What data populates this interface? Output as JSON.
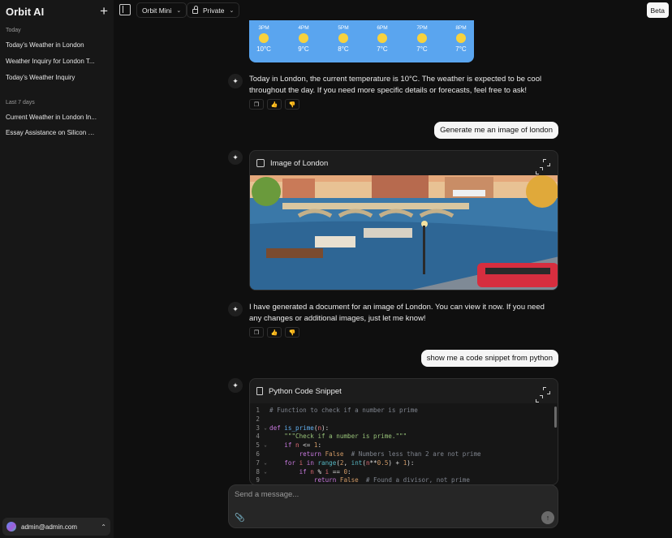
{
  "sidebar": {
    "title": "Orbit AI",
    "new_chat_icon": "plus-icon",
    "groups": [
      {
        "label": "Today",
        "items": [
          "Today's Weather in London",
          "Weather Inquiry for London T...",
          "Today's Weather Inquiry"
        ]
      },
      {
        "label": "Last 7 days",
        "items": [
          "Current Weather in London In...",
          "Essay Assistance on Silicon V..."
        ]
      }
    ],
    "user": {
      "email": "admin@admin.com"
    }
  },
  "topbar": {
    "model": "Orbit Mini",
    "visibility": "Private",
    "badge": "Beta"
  },
  "weather": {
    "hours": [
      {
        "time": "3PM",
        "temp": "10°C"
      },
      {
        "time": "4PM",
        "temp": "9°C"
      },
      {
        "time": "5PM",
        "temp": "8°C"
      },
      {
        "time": "6PM",
        "temp": "7°C"
      },
      {
        "time": "7PM",
        "temp": "7°C"
      },
      {
        "time": "8PM",
        "temp": "7°C"
      }
    ]
  },
  "messages": {
    "assistant_1": "Today in London, the current temperature is 10°C. The weather is expected to be cool throughout the day. If you need more specific details or forecasts, feel free to ask!",
    "user_1": "Generate me an image of london",
    "image_card_title": "Image of London",
    "assistant_2": "I have generated a document for an image of London. You can view it now. If you need any changes or additional images, just let me know!",
    "user_2": "show me a code snippet from python",
    "code_card_title": "Python Code Snippet"
  },
  "code": {
    "lines": [
      {
        "n": "1",
        "fold": "",
        "parts": [
          [
            "c",
            "# Function to check if a number is prime"
          ]
        ]
      },
      {
        "n": "2",
        "fold": "",
        "parts": []
      },
      {
        "n": "3",
        "fold": "⌄",
        "parts": [
          [
            "k",
            "def "
          ],
          [
            "f",
            "is_prime"
          ],
          [
            "t",
            "("
          ],
          [
            "p",
            "n"
          ],
          [
            "t",
            "):"
          ]
        ]
      },
      {
        "n": "4",
        "fold": "",
        "parts": [
          [
            "t",
            "    "
          ],
          [
            "s",
            "\"\"\"Check if a number is prime.\"\"\""
          ]
        ]
      },
      {
        "n": "5",
        "fold": "⌄",
        "parts": [
          [
            "t",
            "    "
          ],
          [
            "k",
            "if "
          ],
          [
            "p",
            "n"
          ],
          [
            "t",
            " <= "
          ],
          [
            "n",
            "1"
          ],
          [
            "t",
            ":"
          ]
        ]
      },
      {
        "n": "6",
        "fold": "",
        "parts": [
          [
            "t",
            "        "
          ],
          [
            "k",
            "return "
          ],
          [
            "n",
            "False"
          ],
          [
            "t",
            "  "
          ],
          [
            "c",
            "# Numbers less than 2 are not prime"
          ]
        ]
      },
      {
        "n": "7",
        "fold": "⌄",
        "parts": [
          [
            "t",
            "    "
          ],
          [
            "k",
            "for "
          ],
          [
            "p",
            "i"
          ],
          [
            "k",
            " in "
          ],
          [
            "b",
            "range"
          ],
          [
            "t",
            "("
          ],
          [
            "n",
            "2"
          ],
          [
            "t",
            ", "
          ],
          [
            "b",
            "int"
          ],
          [
            "t",
            "("
          ],
          [
            "p",
            "n"
          ],
          [
            "t",
            "**"
          ],
          [
            "n",
            "0.5"
          ],
          [
            "t",
            ") + "
          ],
          [
            "n",
            "1"
          ],
          [
            "t",
            "):"
          ]
        ]
      },
      {
        "n": "8",
        "fold": "⌄",
        "parts": [
          [
            "t",
            "        "
          ],
          [
            "k",
            "if "
          ],
          [
            "p",
            "n"
          ],
          [
            "t",
            " % "
          ],
          [
            "p",
            "i"
          ],
          [
            "t",
            " == "
          ],
          [
            "n",
            "0"
          ],
          [
            "t",
            ":"
          ]
        ]
      },
      {
        "n": "9",
        "fold": "",
        "parts": [
          [
            "t",
            "            "
          ],
          [
            "k",
            "return "
          ],
          [
            "n",
            "False"
          ],
          [
            "t",
            "  "
          ],
          [
            "c",
            "# Found a divisor, not prime"
          ]
        ]
      }
    ]
  },
  "composer": {
    "placeholder": "Send a message..."
  }
}
